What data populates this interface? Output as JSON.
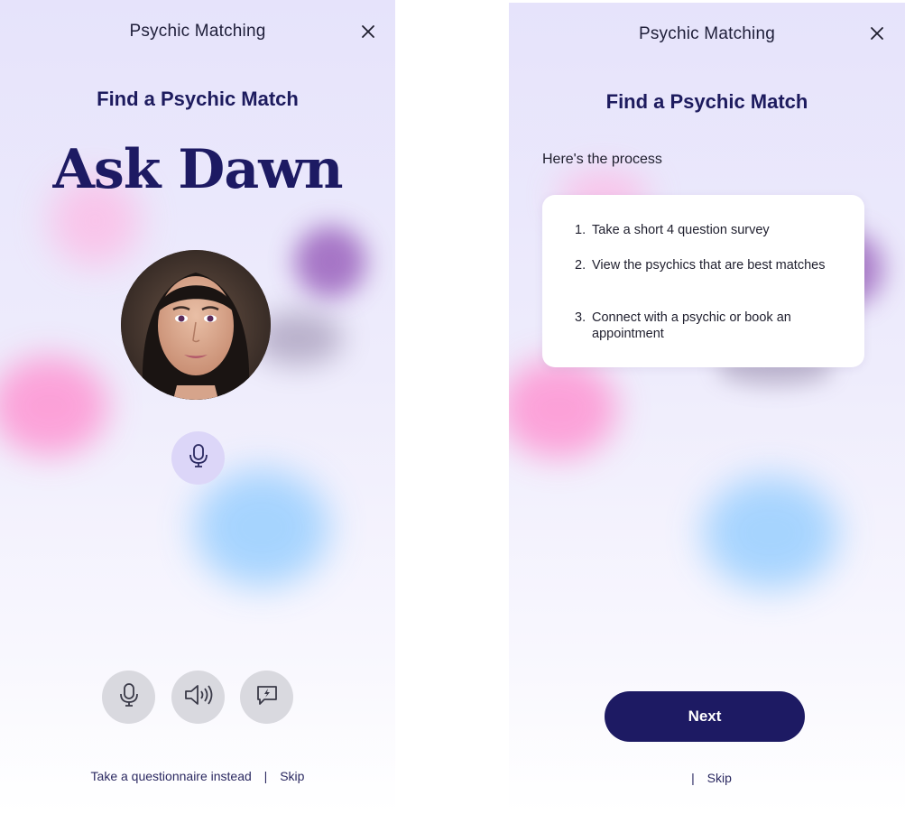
{
  "left_screen": {
    "header_title": "Psychic Matching",
    "subtitle": "Find a Psychic Match",
    "hero_title": "Ask Dawn",
    "footer": {
      "questionnaire_link": "Take a questionnaire instead",
      "separator": "|",
      "skip_link": "Skip"
    },
    "controls": [
      {
        "icon": "microphone-icon"
      },
      {
        "icon": "speaker-icon"
      },
      {
        "icon": "chat-lightning-icon"
      }
    ]
  },
  "right_screen": {
    "header_title": "Psychic Matching",
    "subtitle": "Find a Psychic Match",
    "process_heading": "Here's the process",
    "steps": [
      {
        "num": "1.",
        "text": "Take a short 4 question survey"
      },
      {
        "num": "2.",
        "text": "View the psychics that are best matches"
      },
      {
        "num": "3.",
        "text": "Connect with a psychic or book an appointment"
      }
    ],
    "next_label": "Next",
    "footer": {
      "separator": "|",
      "skip_link": "Skip"
    }
  },
  "colors": {
    "brand_navy": "#1d1a63",
    "background_lavender": "#e6e3fb",
    "blob_pink": "#ff9fd8",
    "blob_purple": "#8a4fb0",
    "blob_blue": "#9fd3ff"
  }
}
